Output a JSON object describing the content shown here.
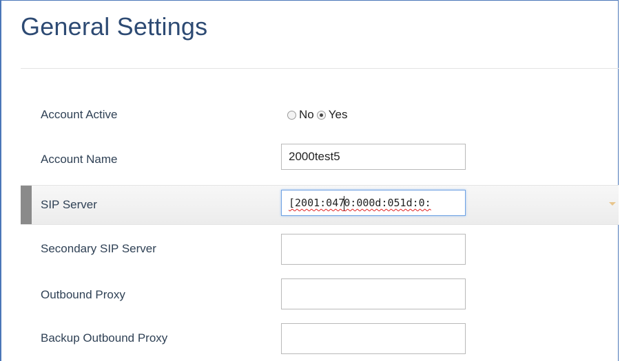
{
  "page": {
    "title": "General Settings"
  },
  "account_active": {
    "label": "Account Active",
    "options": [
      "No",
      "Yes"
    ],
    "selected": "Yes"
  },
  "account_name": {
    "label": "Account Name",
    "value": "2000test5"
  },
  "sip_server": {
    "label": "SIP Server",
    "value_before_caret": "[2001:047",
    "value_after_caret": "0:000d:051d:0:"
  },
  "secondary_sip_server": {
    "label": "Secondary SIP Server",
    "value": ""
  },
  "outbound_proxy": {
    "label": "Outbound Proxy",
    "value": ""
  },
  "backup_outbound_proxy": {
    "label": "Backup Outbound Proxy",
    "value": ""
  },
  "colors": {
    "title": "#2d4a73",
    "label": "#2f4155",
    "focus_border": "#6ea1e3",
    "frame": "#4a76b8"
  }
}
